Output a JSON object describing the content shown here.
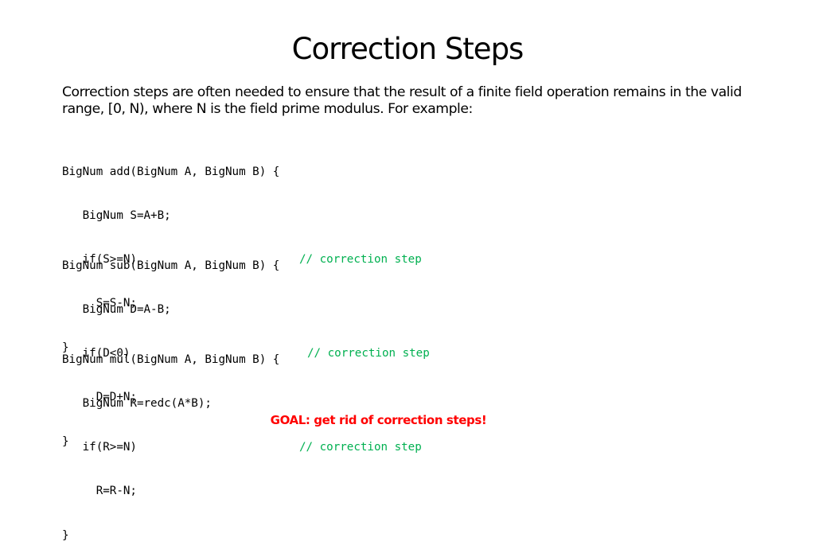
{
  "slide": {
    "title": "Correction Steps",
    "intro": "Correction steps are often needed to ensure that the result of a finite field operation remains in the valid range, [0, N), where N is the field prime modulus.  For example:",
    "code_blocks": [
      {
        "name": "add",
        "lines": [
          "BigNum add(BigNum A, BigNum B) {",
          "   BigNum S=A+B;",
          "   if(S>=N)",
          "     S=S-N;",
          "}"
        ],
        "comment": "// correction step"
      },
      {
        "name": "sub",
        "lines": [
          "BigNum sub(BigNum A, BigNum B) {",
          "   BigNum D=A-B;",
          "   if(D<0)",
          "     D=D+N;",
          "}"
        ],
        "comment": "// correction step"
      },
      {
        "name": "mul",
        "lines": [
          "BigNum mul(BigNum A, BigNum B) {",
          "   BigNum R=redc(A*B);",
          "   if(R>=N)",
          "     R=R-N;",
          "}"
        ],
        "comment": "// correction step"
      }
    ],
    "goal": "GOAL:  get rid of correction steps!",
    "colors": {
      "comment": "#00B050",
      "goal": "#FF0000",
      "text": "#000000",
      "background": "#FFFFFF"
    }
  }
}
